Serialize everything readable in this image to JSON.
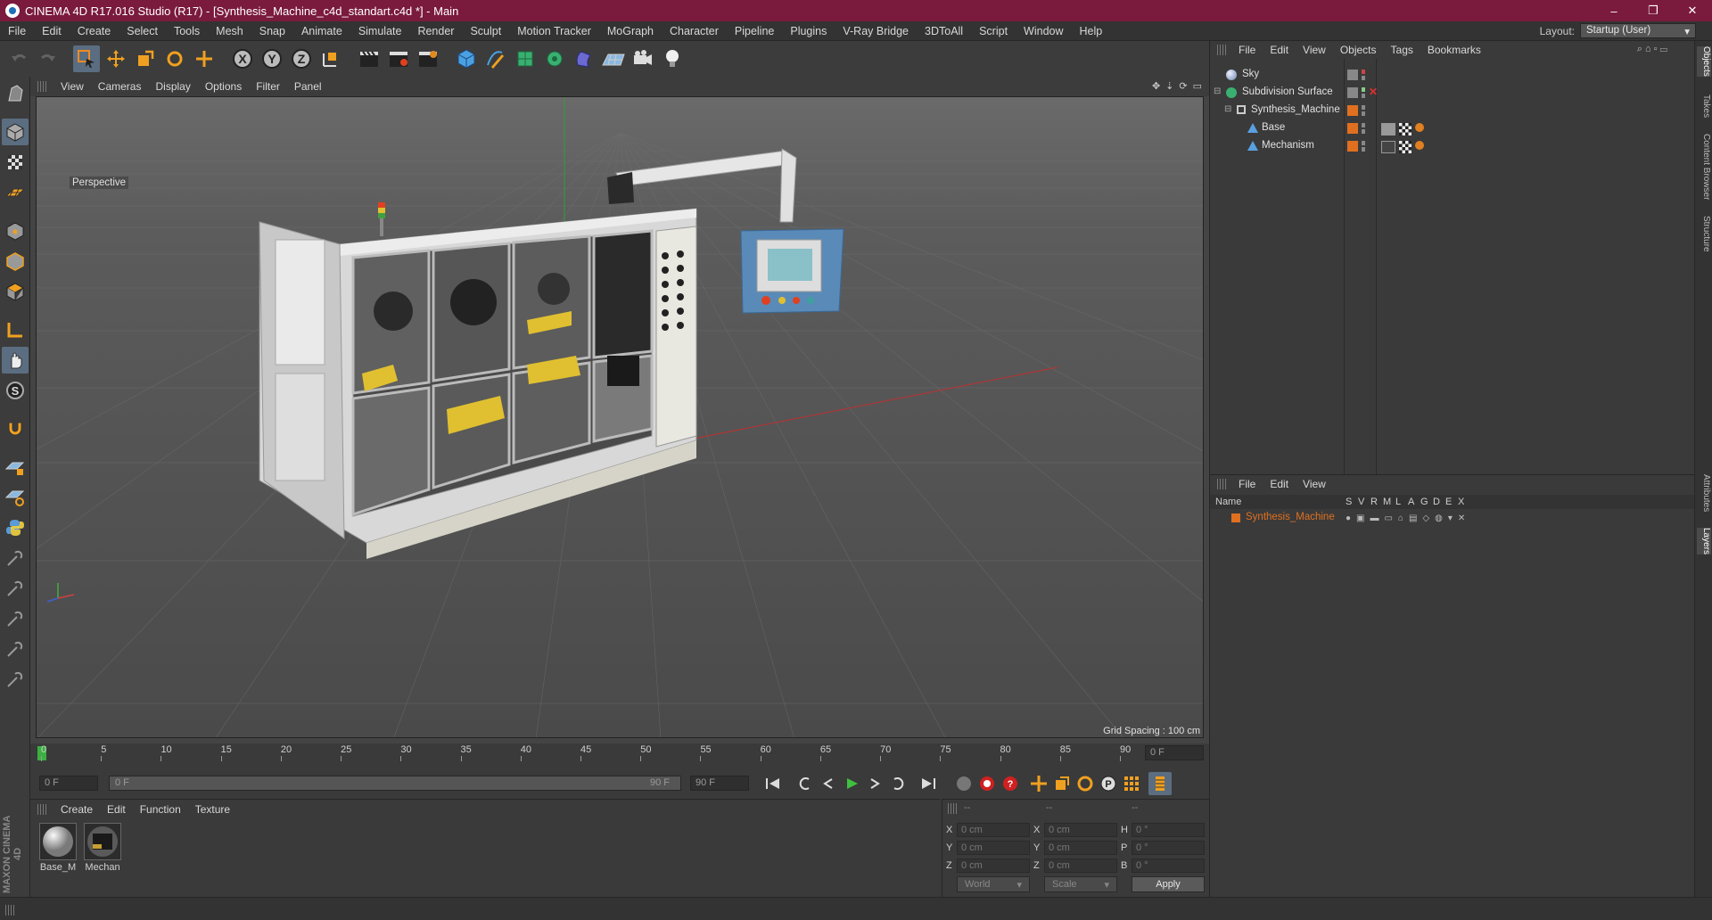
{
  "window": {
    "title": "CINEMA 4D R17.016 Studio (R17) - [Synthesis_Machine_c4d_standart.c4d *] - Main",
    "minimize": "–",
    "maximize": "❐",
    "close": "✕"
  },
  "menubar": [
    "File",
    "Edit",
    "Create",
    "Select",
    "Tools",
    "Mesh",
    "Snap",
    "Animate",
    "Simulate",
    "Render",
    "Sculpt",
    "Motion Tracker",
    "MoGraph",
    "Character",
    "Pipeline",
    "Plugins",
    "V-Ray Bridge",
    "3DToAll",
    "Script",
    "Window",
    "Help"
  ],
  "layout": {
    "label": "Layout:",
    "value": "Startup (User)"
  },
  "toolbar": {
    "axis_x": "X",
    "axis_y": "Y",
    "axis_z": "Z"
  },
  "viewport": {
    "menu": [
      "View",
      "Cameras",
      "Display",
      "Options",
      "Filter",
      "Panel"
    ],
    "camera_label": "Perspective",
    "grid_spacing": "Grid Spacing : 100 cm"
  },
  "timeline": {
    "ticks": [
      "0",
      "5",
      "10",
      "15",
      "20",
      "25",
      "30",
      "35",
      "40",
      "45",
      "50",
      "55",
      "60",
      "65",
      "70",
      "75",
      "80",
      "85",
      "90"
    ],
    "current_frame": "0 F",
    "start": "0 F",
    "range_start": "0 F",
    "range_end": "90 F",
    "end": "90 F"
  },
  "materials": {
    "menu": [
      "Create",
      "Edit",
      "Function",
      "Texture"
    ],
    "items": [
      {
        "name": "Base_M"
      },
      {
        "name": "Mechan"
      }
    ]
  },
  "coords": {
    "head1": "--",
    "head2": "--",
    "head3": "--",
    "rows": [
      {
        "a": "X",
        "av": "0 cm",
        "b": "X",
        "bv": "0 cm",
        "c": "H",
        "cv": "0 °"
      },
      {
        "a": "Y",
        "av": "0 cm",
        "b": "Y",
        "bv": "0 cm",
        "c": "P",
        "cv": "0 °"
      },
      {
        "a": "Z",
        "av": "0 cm",
        "b": "Z",
        "bv": "0 cm",
        "c": "B",
        "cv": "0 °"
      }
    ],
    "mode1": "World",
    "mode2": "Scale",
    "apply": "Apply"
  },
  "objects": {
    "menu": [
      "File",
      "Edit",
      "View",
      "Objects",
      "Tags",
      "Bookmarks"
    ],
    "items": [
      {
        "name": "Sky"
      },
      {
        "name": "Subdivision Surface"
      },
      {
        "name": "Synthesis_Machine"
      },
      {
        "name": "Base"
      },
      {
        "name": "Mechanism"
      }
    ]
  },
  "layers": {
    "menu": [
      "File",
      "Edit",
      "View"
    ],
    "header_name": "Name",
    "header_cols": [
      "S",
      "V",
      "R",
      "M",
      "L",
      "A",
      "G",
      "D",
      "E",
      "X"
    ],
    "items": [
      {
        "name": "Synthesis_Machine",
        "color": "#e07020"
      }
    ]
  },
  "sidetabs": [
    "Objects",
    "Takes",
    "Content Browser",
    "Structure",
    "Attributes",
    "Layers"
  ],
  "brand": "MAXON CINEMA 4D",
  "colors": {
    "title_bar": "#7a1a3c",
    "accent_orange": "#e07020",
    "selection": "#5b6d80"
  }
}
